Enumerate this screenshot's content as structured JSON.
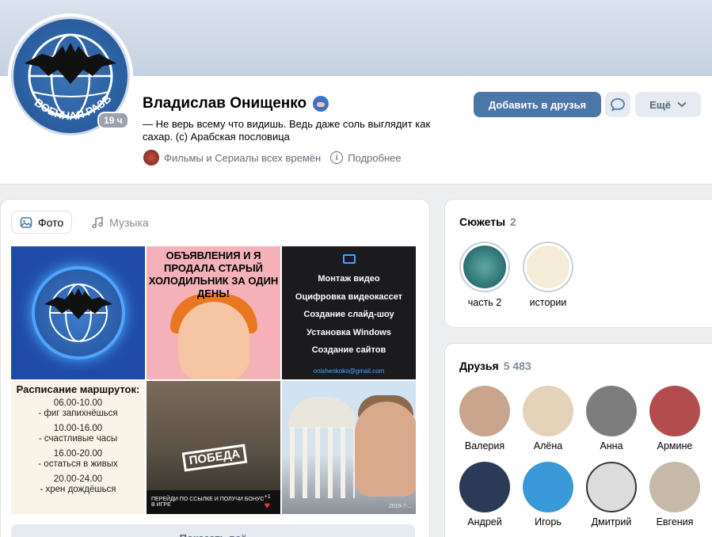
{
  "profile": {
    "name": "Владислав Онищенко",
    "status": "— Не верь всему что видишь. Ведь даже соль выглядит как сахар. (с) Арабская пословица",
    "time_badge": "19 ч",
    "avatar_text": "ВОЕННАЯ РАЗВЕДКА",
    "group": "Фильмы и Сериалы всех времён",
    "details": "Подробнее"
  },
  "actions": {
    "add_friend": "Добавить в друзья",
    "more": "Ещё"
  },
  "media": {
    "tabs": [
      {
        "label": "Фото",
        "active": true
      },
      {
        "label": "Музыка",
        "active": false
      }
    ],
    "photo2_text": "ОБЪЯВЛЕНИЯ И Я ПРОДАЛА СТАРЫЙ ХОЛОДИЛЬНИК ЗА ОДИН ДЕНЬ!",
    "photo3_rows": [
      "Монтаж видео",
      "Оцифровка видеокассет",
      "Создание слайд-шоу",
      "Установка Windows",
      "Создание сайтов"
    ],
    "photo3_mail": "onishenkoko@gmail.com",
    "photo4_title": "Расписание маршруток:",
    "photo4_lines": [
      "06.00-10.00",
      "- фиг запихнёшься",
      "10.00-16.00",
      "- счастливые часы",
      "16.00-20.00",
      "- остаться в живых",
      "20.00-24.00",
      "- хрен дождёшься"
    ],
    "photo5_label": "ПОБЕДА",
    "photo5_bottom": "ПЕРЕЙДИ ПО ССЫЛКЕ И ПОЛУЧИ БОНУС В ИГРЕ",
    "photo5_count": "+1",
    "photo6_date": "2019-7-...",
    "show_all": "Показать всё"
  },
  "stories": {
    "title": "Сюжеты",
    "count": "2",
    "items": [
      {
        "label": "часть 2"
      },
      {
        "label": "истории"
      }
    ]
  },
  "friends": {
    "title": "Друзья",
    "count": "5 483",
    "items": [
      {
        "name": "Валерия",
        "color": "#c9a58e"
      },
      {
        "name": "Алёна",
        "color": "#e4d3b8"
      },
      {
        "name": "Анна",
        "color": "#7d7d7d"
      },
      {
        "name": "Армине",
        "color": "#b34c4c"
      },
      {
        "name": "Андрей",
        "color": "#2b3a57"
      },
      {
        "name": "Игорь",
        "color": "#3a9ad9"
      },
      {
        "name": "Дмитрий",
        "color": "#dcdcdc"
      },
      {
        "name": "Евгения",
        "color": "#c7b9a8"
      }
    ]
  },
  "colors": {
    "accent": "#4a76a8",
    "secondary_button": "#e5ebf1",
    "page_bg": "#edeef0"
  }
}
